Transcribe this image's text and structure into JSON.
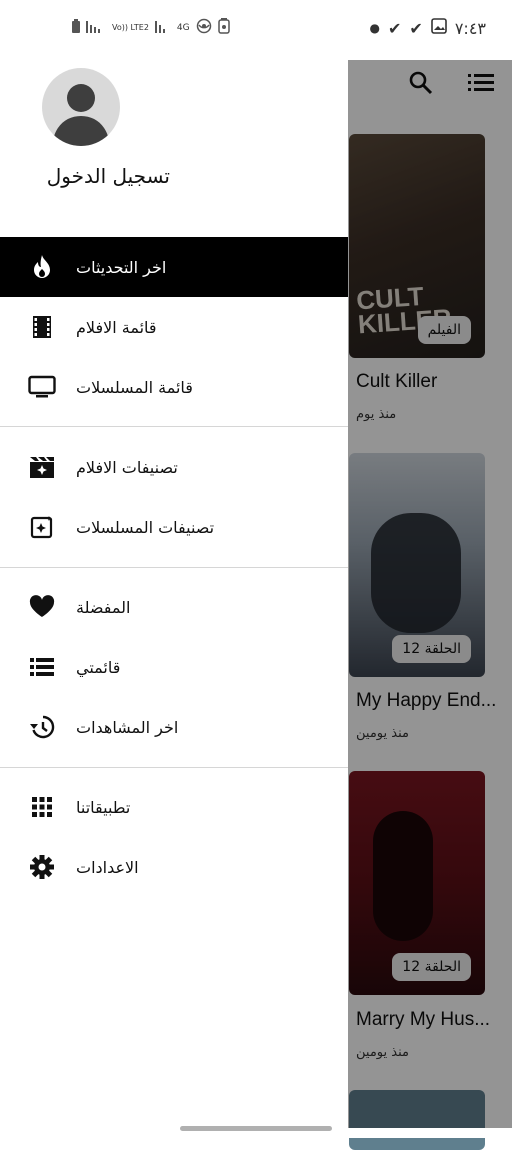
{
  "status_bar": {
    "time": "٧:٤٣",
    "network_left": "Vo)) LTE2",
    "network_4g": "4G"
  },
  "drawer": {
    "login_label": "تسجيل الدخول",
    "items": [
      {
        "label": "اخر التحديثات",
        "icon": "flame-icon",
        "active": true
      },
      {
        "label": "قائمة الافلام",
        "icon": "film-icon"
      },
      {
        "label": "قائمة المسلسلات",
        "icon": "tv-icon"
      },
      {
        "label": "تصنيفات الافلام",
        "icon": "movie-sparkle-icon"
      },
      {
        "label": "تصنيفات المسلسلات",
        "icon": "sparkle-box-icon"
      },
      {
        "label": "المفضلة",
        "icon": "heart-icon"
      },
      {
        "label": "قائمتي",
        "icon": "list-icon"
      },
      {
        "label": "اخر المشاهدات",
        "icon": "history-icon"
      },
      {
        "label": "تطبيقاتنا",
        "icon": "apps-grid-icon"
      },
      {
        "label": "الاعدادات",
        "icon": "gear-icon"
      }
    ]
  },
  "content": {
    "cards": [
      {
        "title": "Cult Killer",
        "meta": "منذ يوم",
        "badge": "الفيلم",
        "poster_text": "CULT KILLER"
      },
      {
        "title": "My Happy End...",
        "meta": "منذ يومين",
        "badge": "الحلقة 12"
      },
      {
        "title": "Marry My Hus...",
        "meta": "منذ يومين",
        "badge": "الحلقة 12"
      }
    ]
  },
  "colors": {
    "active_bg": "#000000",
    "accent": "#000000"
  }
}
